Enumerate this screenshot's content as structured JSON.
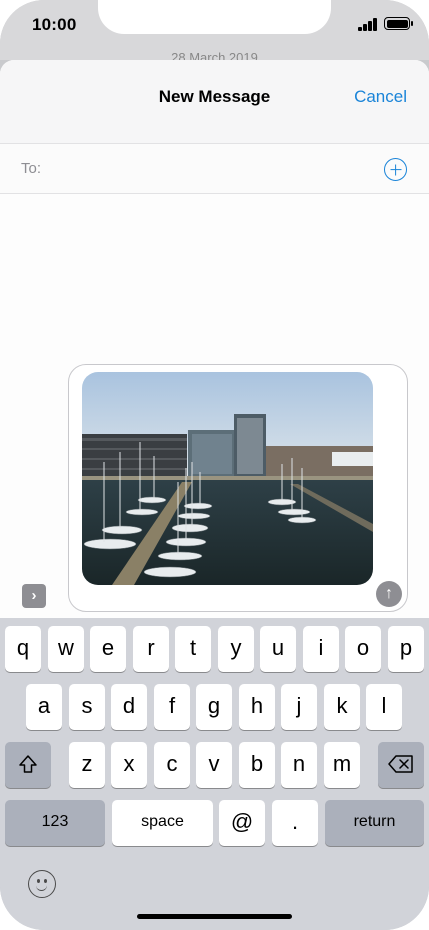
{
  "status_bar": {
    "time": "10:00",
    "peek_text": "28 March 2019"
  },
  "nav": {
    "title": "New Message",
    "cancel_label": "Cancel"
  },
  "recipient": {
    "label": "To:"
  },
  "keyboard": {
    "row1": [
      "q",
      "w",
      "e",
      "r",
      "t",
      "y",
      "u",
      "i",
      "o",
      "p"
    ],
    "row2": [
      "a",
      "s",
      "d",
      "f",
      "g",
      "h",
      "j",
      "k",
      "l"
    ],
    "row3": [
      "z",
      "x",
      "c",
      "v",
      "b",
      "n",
      "m"
    ],
    "numbers_label": "123",
    "space_label": "space",
    "at_label": "@",
    "dot_label": ".",
    "return_label": "return"
  },
  "icons": {
    "expand": "chevron-right-icon",
    "send": "arrow-up-icon",
    "add_contact": "plus-circle-icon",
    "shift": "shift-icon",
    "delete": "backspace-icon",
    "emoji": "emoji-icon"
  },
  "colors": {
    "accent": "#1a84d8",
    "keyboard_bg": "#d1d3d9",
    "send_disabled": "#8e8e93"
  }
}
